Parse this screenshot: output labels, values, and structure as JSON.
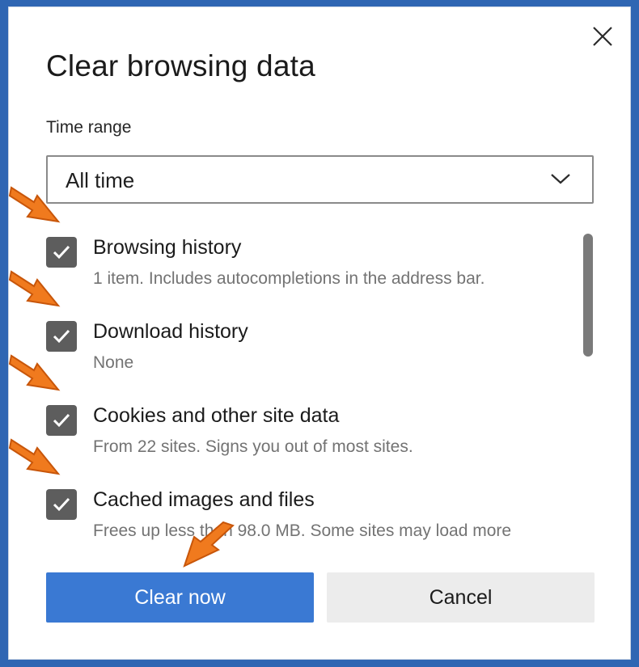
{
  "dialog": {
    "title": "Clear browsing data",
    "close_icon": "close-icon"
  },
  "time_range": {
    "label": "Time range",
    "selected": "All time",
    "chevron_icon": "chevron-down-icon"
  },
  "options": [
    {
      "label": "Browsing history",
      "description": "1 item. Includes autocompletions in the address bar.",
      "checked": true
    },
    {
      "label": "Download history",
      "description": "None",
      "checked": true
    },
    {
      "label": "Cookies and other site data",
      "description": "From 22 sites. Signs you out of most sites.",
      "checked": true
    },
    {
      "label": "Cached images and files",
      "description": "Frees up less than 98.0 MB. Some sites may load more",
      "checked": true
    }
  ],
  "buttons": {
    "clear_label": "Clear now",
    "cancel_label": "Cancel"
  },
  "colors": {
    "background": "#2f66b3",
    "primary_button": "#3a79d3",
    "checkbox": "#5d5d5d",
    "annotation_arrow": "#f07a1e"
  }
}
